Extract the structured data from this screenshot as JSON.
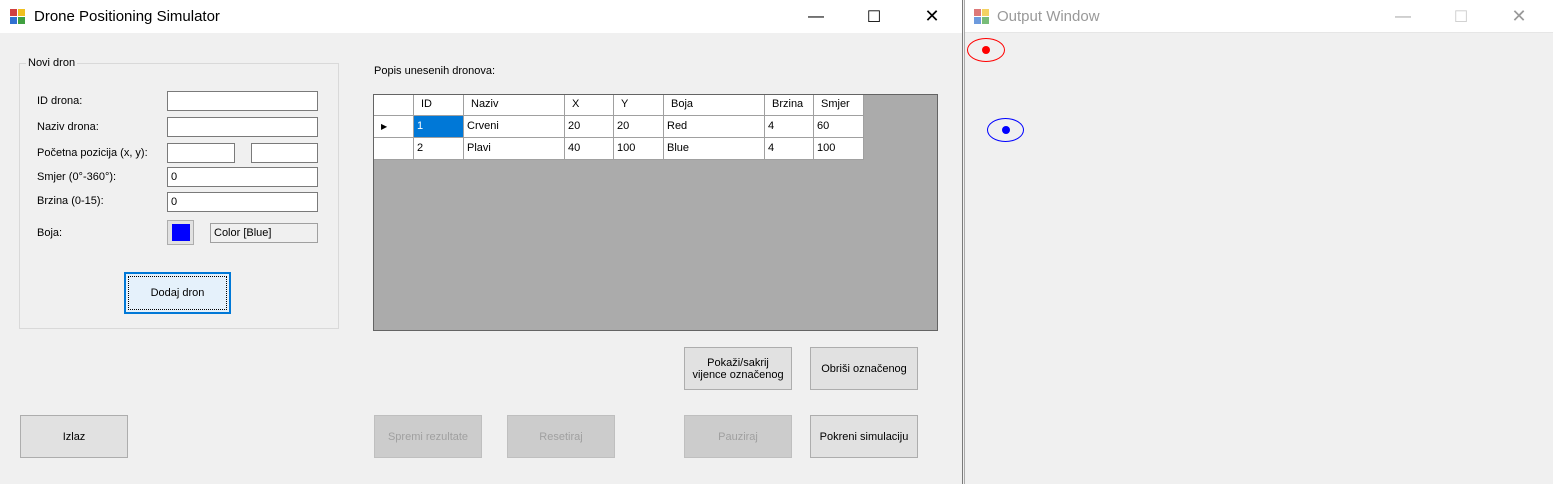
{
  "main_window": {
    "title": "Drone Positioning Simulator",
    "controls": {
      "minimize": "—",
      "maximize": "☐",
      "close": "✕"
    }
  },
  "new_drone": {
    "group_title": "Novi dron",
    "id_label": "ID drona:",
    "id_value": "",
    "name_label": "Naziv drona:",
    "name_value": "",
    "pos_label": "Početna pozicija (x, y):",
    "pos_x_value": "",
    "pos_y_value": "",
    "direction_label": "Smjer (0°-360°):",
    "direction_value": "0",
    "speed_label": "Brzina (0-15):",
    "speed_value": "0",
    "color_label": "Boja:",
    "color_swatch": "#0000ff",
    "color_value": "Color [Blue]",
    "add_button": "Dodaj dron"
  },
  "drone_list": {
    "title": "Popis unesenih dronova:",
    "columns": [
      "ID",
      "Naziv",
      "X",
      "Y",
      "Boja",
      "Brzina",
      "Smjer"
    ],
    "rows": [
      [
        "1",
        "Crveni",
        "20",
        "20",
        "Red",
        "4",
        "60"
      ],
      [
        "2",
        "Plavi",
        "40",
        "100",
        "Blue",
        "4",
        "100"
      ]
    ]
  },
  "buttons": {
    "toggle_wreath": "Pokaži/sakrij\nvijence označenog",
    "delete_selected": "Obriši označenog",
    "exit": "Izlaz",
    "save_results": "Spremi rezultate",
    "reset": "Resetiraj",
    "pause": "Pauziraj",
    "start_simulation": "Pokreni simulaciju"
  },
  "output_window": {
    "title": "Output Window",
    "controls": {
      "minimize": "—",
      "maximize": "☐",
      "close": "✕"
    },
    "drones": [
      {
        "name": "Crveni",
        "color": "#ff0000"
      },
      {
        "name": "Plavi",
        "color": "#0000ff"
      }
    ]
  }
}
